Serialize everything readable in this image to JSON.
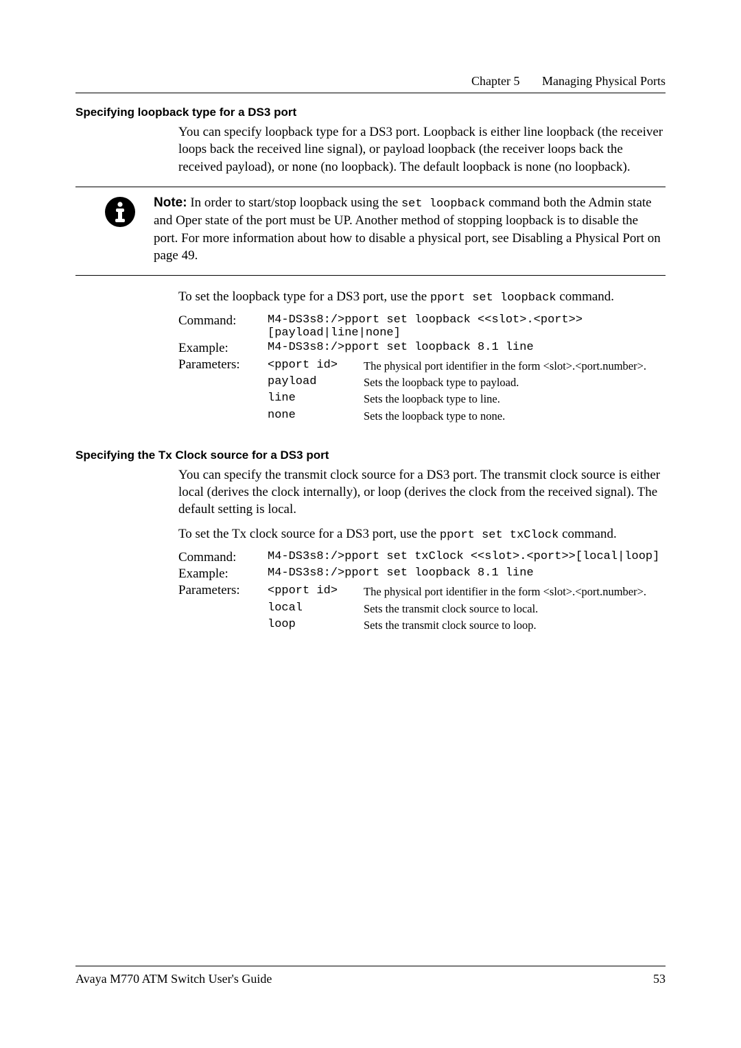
{
  "header": {
    "chapter_label": "Chapter 5",
    "chapter_title": "Managing Physical Ports"
  },
  "section1": {
    "heading": "Specifying loopback type for a DS3  port",
    "body": "You can specify loopback type for a DS3 port.  Loopback is either line loopback (the receiver loops back the received line signal), or payload loopback (the receiver loops back the received payload), or none (no loopback). The default loopback is none (no loopback).",
    "note_label": "Note:",
    "note_body_1": "In order to start/stop loopback using the ",
    "note_code": "set loopback",
    "note_body_2": " command both the Admin state and Oper state of the port must be UP.  Another method of stopping loopback is to disable the port. For more information about how to disable a physical port, see Disabling a Physical Port on page 49.",
    "intro": "To set the loopback type for a DS3 port, use the ",
    "intro_code": "pport set loopback",
    "intro_tail": " command.",
    "labels": {
      "command": "Command:",
      "example": "Example:",
      "parameters": "Parameters:"
    },
    "command": "M4-DS3s8:/>pport set loopback <<slot>.<port>>[payload|line|none]",
    "example": "M4-DS3s8:/>pport set loopback 8.1 line",
    "params": [
      {
        "key": "<pport id>",
        "desc": "The physical port identifier in the form <slot>.<port.number>."
      },
      {
        "key": "payload",
        "desc": "Sets the loopback type to payload."
      },
      {
        "key": "line",
        "desc": "Sets the loopback type to line."
      },
      {
        "key": "none",
        "desc": "Sets the loopback type to none."
      }
    ]
  },
  "section2": {
    "heading": "Specifying the Tx Clock source for a DS3  port",
    "body": "You can specify the transmit clock source for a DS3 port.  The transmit clock source is either local (derives the clock internally), or loop (derives the clock from the received signal). The default setting is local.",
    "intro": "To set the Tx clock source for a DS3 port, use the ",
    "intro_code": "pport set txClock",
    "intro_tail": " command.",
    "labels": {
      "command": "Command:",
      "example": "Example:",
      "parameters": "Parameters:"
    },
    "command": "M4-DS3s8:/>pport set txClock <<slot>.<port>>[local|loop]",
    "example": "M4-DS3s8:/>pport set loopback 8.1 line",
    "params": [
      {
        "key": "<pport id>",
        "desc": "The physical port identifier in the form <slot>.<port.number>."
      },
      {
        "key": "local",
        "desc": "Sets the transmit clock source to local."
      },
      {
        "key": "loop",
        "desc": "Sets the transmit clock source to loop."
      }
    ]
  },
  "footer": {
    "left": "Avaya M770 ATM Switch User's Guide",
    "right": "53"
  }
}
